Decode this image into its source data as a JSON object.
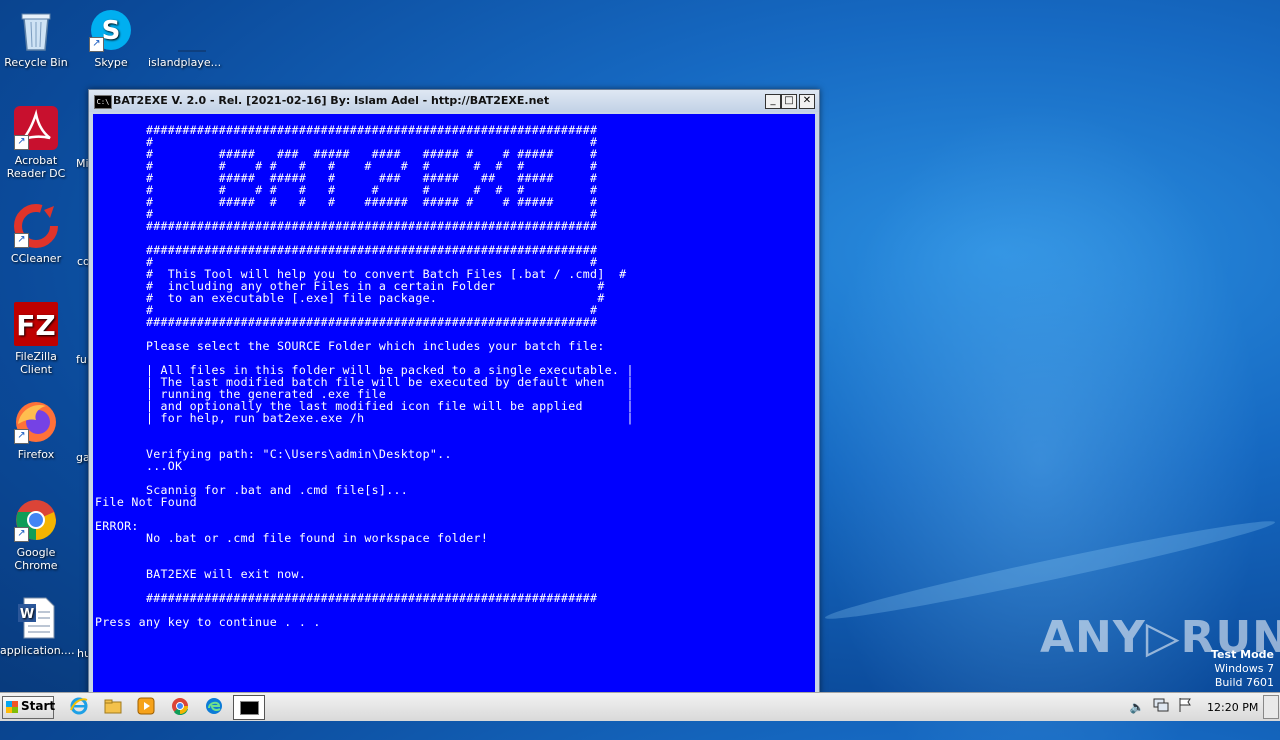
{
  "desktop": {
    "icons": [
      {
        "label": "Recycle Bin",
        "icon": "recycle-bin-icon"
      },
      {
        "label": "Skype",
        "icon": "skype-icon"
      },
      {
        "label": "islandplaye...",
        "icon": "blank-file-icon"
      },
      {
        "label": "Acrobat Reader DC",
        "icon": "acrobat-icon"
      },
      {
        "label": "CCleaner",
        "icon": "ccleaner-icon"
      },
      {
        "label": "FileZilla Client",
        "icon": "filezilla-icon"
      },
      {
        "label": "Firefox",
        "icon": "firefox-icon"
      },
      {
        "label": "Google Chrome",
        "icon": "chrome-icon"
      },
      {
        "label": "application....",
        "icon": "word-document-icon"
      }
    ],
    "partial_labels": [
      "Mi",
      "co",
      "fu",
      "ga",
      "hu"
    ]
  },
  "window": {
    "title": "BAT2EXE V. 2.0 - Rel. [2021-02-16] By: Islam Adel - http://BAT2EXE.net",
    "minimize": "_",
    "maximize": "□",
    "close": "✕",
    "lines": [
      "       ##############################################################",
      "       #                                                            #",
      "       #         #####   ###  #####   ####   ##### #    # #####     #",
      "       #         #    # #   #   #    #    #  #      #  #  #         #",
      "       #         #####  #####   #      ###   #####   ##   #####     #",
      "       #         #    # #   #   #     #      #      #  #  #         #",
      "       #         #####  #   #   #    ######  ##### #    # #####     #",
      "       #                                                            #",
      "       ##############################################################",
      "",
      "       ##############################################################",
      "       #                                                            #",
      "       #  This Tool will help you to convert Batch Files [.bat / .cmd]  #",
      "       #  including any other Files in a certain Folder              #",
      "       #  to an executable [.exe] file package.                      #",
      "       #                                                            #",
      "       ##############################################################",
      "",
      "       Please select the SOURCE Folder which includes your batch file:",
      "",
      "       | All files in this folder will be packed to a single executable. |",
      "       | The last modified batch file will be executed by default when   |",
      "       | running the generated .exe file                                 |",
      "       | and optionally the last modified icon file will be applied      |",
      "       | for help, run bat2exe.exe /h                                    |",
      "",
      "",
      "       Verifying path: \"C:\\Users\\admin\\Desktop\"..",
      "       ...OK",
      "",
      "       Scannig for .bat and .cmd file[s]...",
      "File Not Found",
      "",
      "ERROR:",
      "       No .bat or .cmd file found in workspace folder!",
      "",
      "",
      "       BAT2EXE will exit now.",
      "",
      "       ##############################################################",
      "",
      "Press any key to continue . . ."
    ]
  },
  "taskbar": {
    "start_label": "Start",
    "clock": "12:20 PM"
  },
  "watermark": {
    "brand": "ANY▷RUN",
    "test_mode": "Test Mode",
    "os": "Windows 7",
    "build": "Build 7601"
  }
}
